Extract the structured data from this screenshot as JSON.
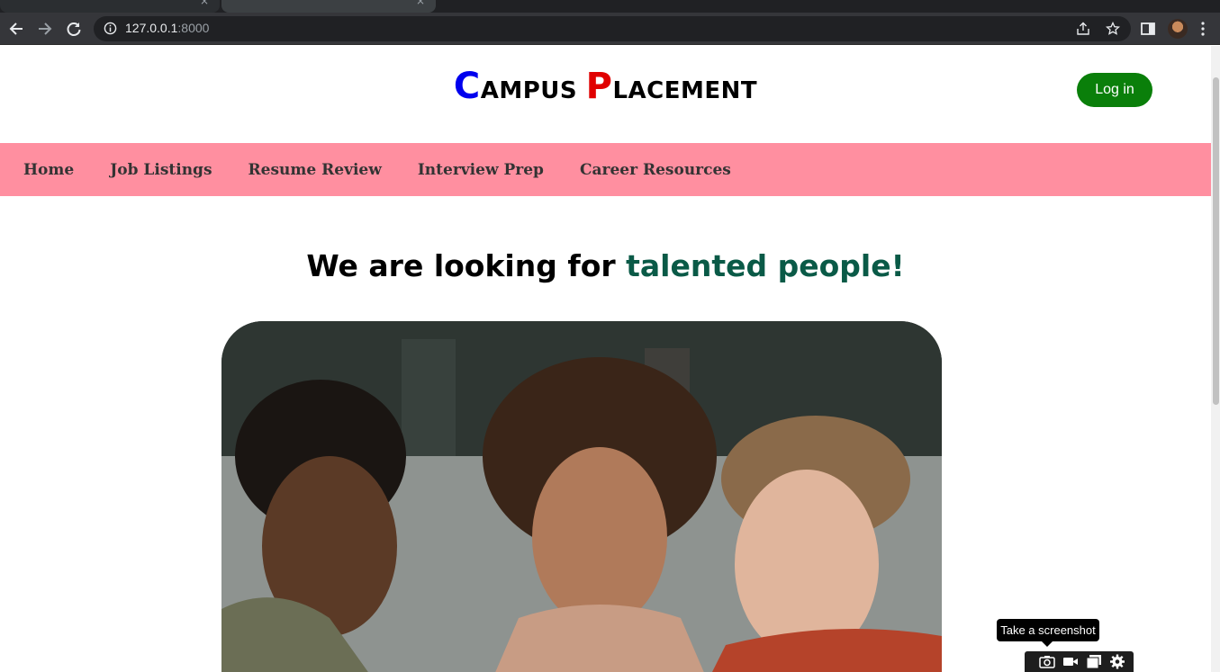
{
  "browser": {
    "url_host": "127.0.0.1",
    "url_port": ":8000"
  },
  "header": {
    "brand_word1_initial": "C",
    "brand_word1_rest": "AMPUS",
    "brand_word2_initial": "P",
    "brand_word2_rest": "LACEMENT",
    "login_label": "Log in"
  },
  "nav": {
    "items": [
      {
        "label": "Home"
      },
      {
        "label": "Job Listings"
      },
      {
        "label": "Resume Review"
      },
      {
        "label": "Interview Prep"
      },
      {
        "label": "Career Resources"
      }
    ]
  },
  "main": {
    "headline_prefix": "We are looking for",
    "headline_highlight": "talented people!"
  },
  "screenshot_tool": {
    "tooltip": "Take a screenshot"
  },
  "colors": {
    "brand_c": "#0000ee",
    "brand_p": "#e00000",
    "nav_bg": "#ff8fa0",
    "login_bg": "#0a7f0a",
    "highlight": "#0a5a47"
  },
  "icons": [
    "back-icon",
    "forward-icon",
    "reload-icon",
    "info-icon",
    "share-icon",
    "star-icon",
    "sidepanel-icon",
    "kebab-menu-icon",
    "camera-icon",
    "video-icon",
    "window-icon",
    "gear-icon"
  ]
}
